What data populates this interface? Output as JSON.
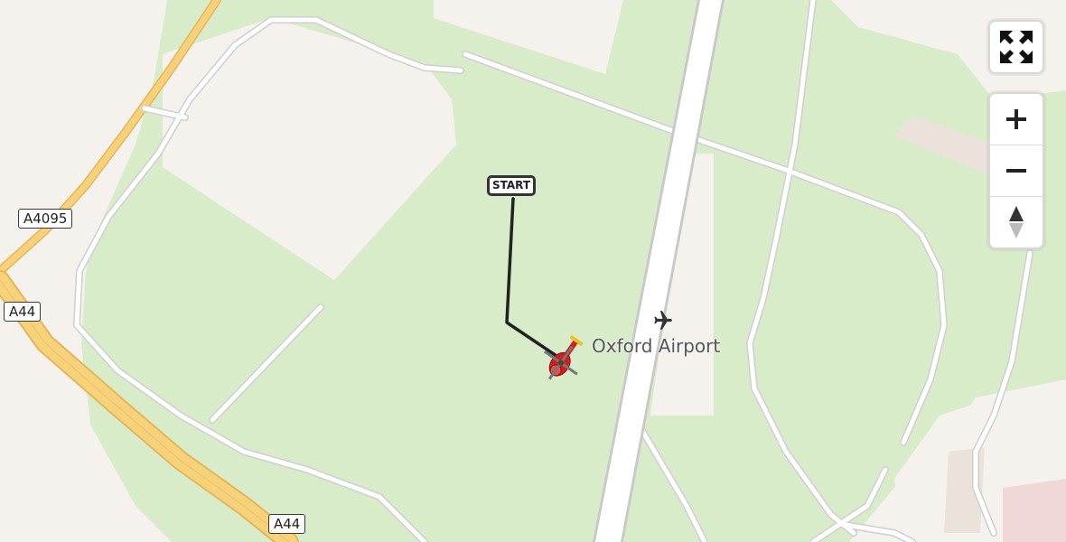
{
  "map": {
    "colors": {
      "land": "#f5f2ee",
      "grass": "#d8ebcb",
      "road_major": "#f5c96a",
      "road_minor": "#ffffff",
      "runway": "#ffffff",
      "route": "#222222",
      "helicopter": "#d11f1f"
    },
    "road_labels": [
      "A4095",
      "A44",
      "A44"
    ],
    "poi": {
      "name": "Oxford Airport",
      "icon": "airplane-icon"
    },
    "route_start_label": "START",
    "vehicle_icon": "helicopter-icon"
  },
  "controls": {
    "fullscreen_icon": "fullscreen-icon",
    "zoom_in_icon": "plus-icon",
    "zoom_out_icon": "minus-icon",
    "compass_icon": "compass-icon"
  }
}
